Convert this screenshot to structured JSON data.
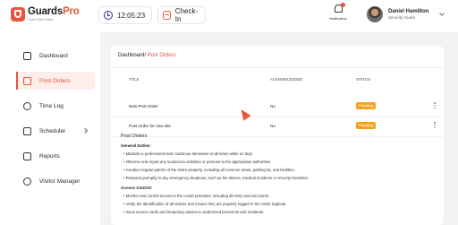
{
  "header": {
    "logo": {
      "brand": "Guards",
      "brand_accent": "Pro",
      "sub": "Guard Web Portal"
    },
    "time": "12:05:23",
    "checkin_label": "Check-In",
    "notification_label": "Notification",
    "user": {
      "name": "Daniel Hamilton",
      "role": "Security Guard"
    }
  },
  "sidebar": {
    "items": [
      {
        "label": "Dashboard",
        "icon": "dashboard-icon"
      },
      {
        "label": "Post Orders",
        "icon": "post-orders-icon"
      },
      {
        "label": "Time Log",
        "icon": "clock-icon"
      },
      {
        "label": "Scheduler",
        "icon": "calendar-icon"
      },
      {
        "label": "Reports",
        "icon": "reports-icon"
      },
      {
        "label": "Visitor Manager",
        "icon": "visitor-icon"
      }
    ]
  },
  "breadcrumb": {
    "root": "Dashboard/",
    "current": " Post Orders"
  },
  "table": {
    "columns": [
      "TITLE",
      "ACKNOWLEDGED",
      "STATUS"
    ],
    "rows": [
      {
        "title": "New Post Order",
        "acknowledged": "No",
        "status": "Pending"
      },
      {
        "title": "Post Order for new site",
        "acknowledged": "No",
        "status": "Pending"
      }
    ]
  },
  "details": {
    "title": "Post Orders",
    "general_heading": "General Duties:",
    "general": [
      "• Maintain a professional and courteous demeanor at all times while on duty.",
      "• Observe and report any suspicious activities or persons to the appropriate authorities.",
      "• Conduct regular patrols of the entire property, including all common areas, parking lot, and facilities.",
      "• Respond promptly to any emergency situations, such as fire alarms, medical incidents or security breaches."
    ],
    "access_heading": "Access Control:",
    "access": [
      "• Monitor and control access to the condo premises, including all entry and exit points.",
      "• Verify the identification of all visitors and ensure they are properly logged in the visitor logbook.",
      "• Issue access cards and temporary passes to authorized personnel and residents."
    ]
  },
  "colors": {
    "accent": "#e8553e",
    "pending": "#f5a21a",
    "clock_icon": "#2a2a9e"
  }
}
